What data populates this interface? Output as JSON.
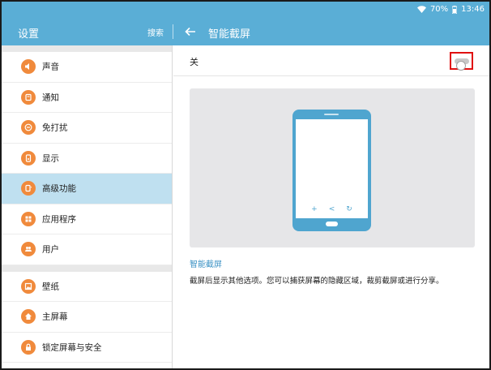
{
  "status_bar": {
    "battery": "70%",
    "time": "13:46"
  },
  "app_bar": {
    "title": "设置",
    "search_label": "搜索",
    "page_title": "智能截屏"
  },
  "sidebar": {
    "groups": [
      [
        {
          "label": "声音",
          "icon": "volume-icon"
        },
        {
          "label": "通知",
          "icon": "notification-icon"
        },
        {
          "label": "免打扰",
          "icon": "do-not-disturb-icon"
        },
        {
          "label": "显示",
          "icon": "display-icon"
        },
        {
          "label": "高级功能",
          "icon": "advanced-features-icon",
          "active": true
        },
        {
          "label": "应用程序",
          "icon": "apps-icon"
        },
        {
          "label": "用户",
          "icon": "users-icon"
        }
      ],
      [
        {
          "label": "壁纸",
          "icon": "wallpaper-icon"
        },
        {
          "label": "主屏幕",
          "icon": "home-icon"
        },
        {
          "label": "锁定屏幕与安全",
          "icon": "lock-icon"
        }
      ]
    ]
  },
  "main": {
    "toggle_label": "关",
    "toggle_on": false,
    "section_title": "智能截屏",
    "description": "截屏后显示其他选项。您可以捕获屏幕的隐藏区域，裁剪截屏或进行分享。",
    "phone_actions": [
      "+",
      "<",
      "↻"
    ]
  },
  "colors": {
    "accent": "#5aaed6",
    "icon_orange": "#f08a3c",
    "active_row": "#bfe0f0",
    "link": "#3b92c4",
    "highlight": "#e01010"
  }
}
